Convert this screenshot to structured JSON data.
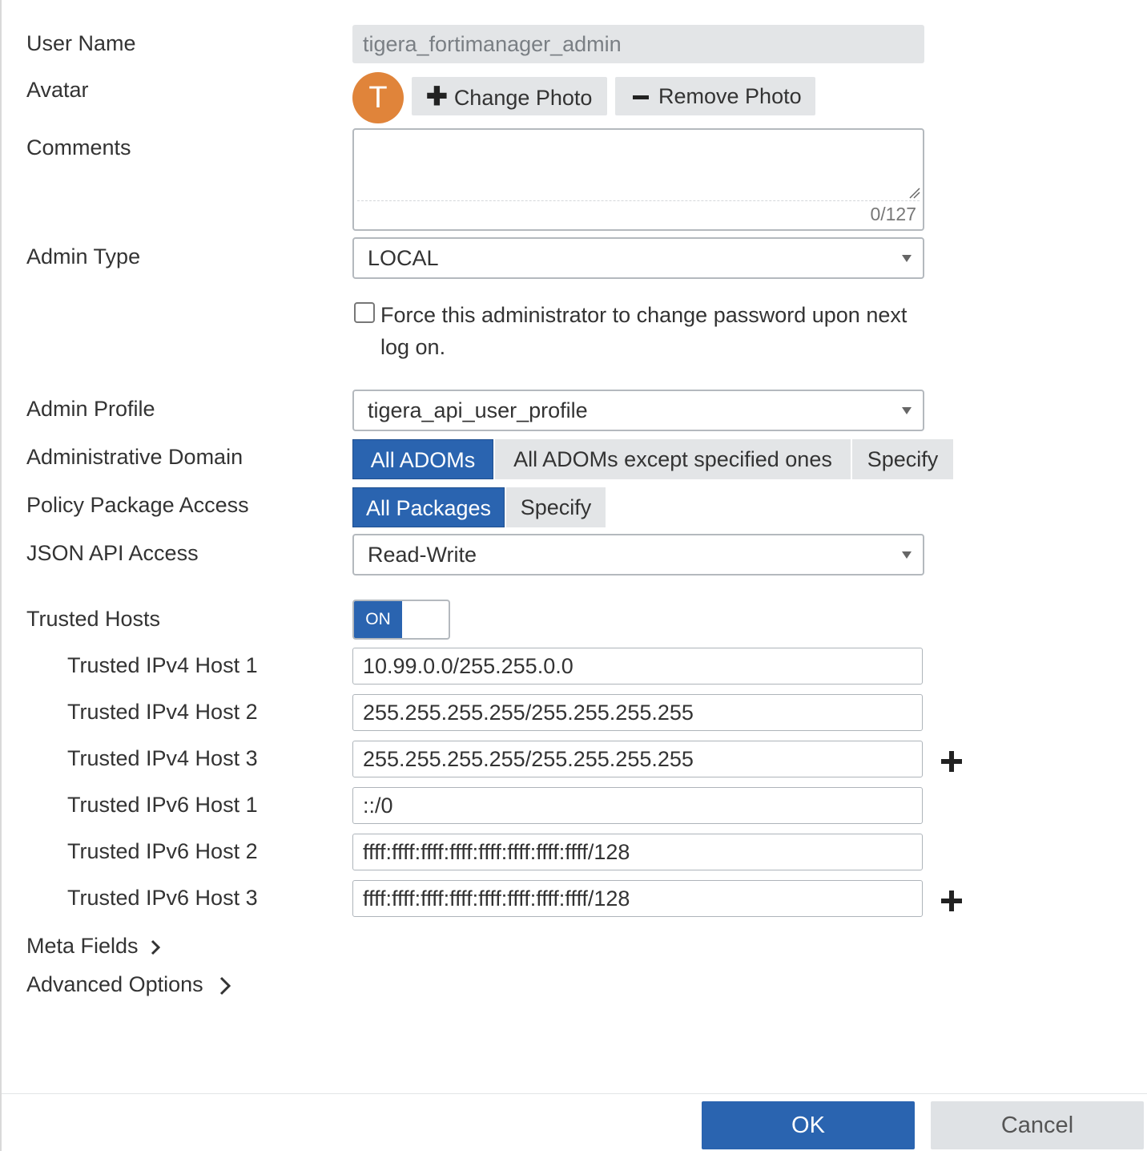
{
  "form": {
    "user_name": {
      "label": "User Name",
      "value": "tigera_fortimanager_admin"
    },
    "avatar": {
      "label": "Avatar",
      "initial": "T",
      "color": "#e0843a",
      "change_photo_label": "Change Photo",
      "remove_photo_label": "Remove Photo"
    },
    "comments": {
      "label": "Comments",
      "value": "",
      "counter": "0/127"
    },
    "admin_type": {
      "label": "Admin Type",
      "value": "LOCAL"
    },
    "force_password": {
      "label": "Force this administrator to change password upon next log on.",
      "checked": false
    },
    "admin_profile": {
      "label": "Admin Profile",
      "value": "tigera_api_user_profile"
    },
    "administrative_domain": {
      "label": "Administrative Domain",
      "options": [
        "All ADOMs",
        "All ADOMs except specified ones",
        "Specify"
      ],
      "selected": "All ADOMs"
    },
    "policy_package_access": {
      "label": "Policy Package Access",
      "options": [
        "All Packages",
        "Specify"
      ],
      "selected": "All Packages"
    },
    "json_api_access": {
      "label": "JSON API Access",
      "value": "Read-Write"
    },
    "trusted_hosts": {
      "label": "Trusted Hosts",
      "toggle_label": "ON",
      "enabled": true,
      "hosts": [
        {
          "label": "Trusted IPv4 Host 1",
          "value": "10.99.0.0/255.255.0.0"
        },
        {
          "label": "Trusted IPv4 Host 2",
          "value": "255.255.255.255/255.255.255.255"
        },
        {
          "label": "Trusted IPv4 Host 3",
          "value": "255.255.255.255/255.255.255.255"
        },
        {
          "label": "Trusted IPv6 Host 1",
          "value": "::/0"
        },
        {
          "label": "Trusted IPv6 Host 2",
          "value": "ffff:ffff:ffff:ffff:ffff:ffff:ffff:ffff/128"
        },
        {
          "label": "Trusted IPv6 Host 3",
          "value": "ffff:ffff:ffff:ffff:ffff:ffff:ffff:ffff/128"
        }
      ]
    },
    "meta_fields": {
      "label": "Meta Fields"
    },
    "advanced_options": {
      "label": "Advanced Options"
    }
  },
  "footer": {
    "ok_label": "OK",
    "cancel_label": "Cancel"
  },
  "colors": {
    "accent": "#2a64b0",
    "avatar": "#e0843a",
    "button_gray": "#e3e5e7"
  }
}
